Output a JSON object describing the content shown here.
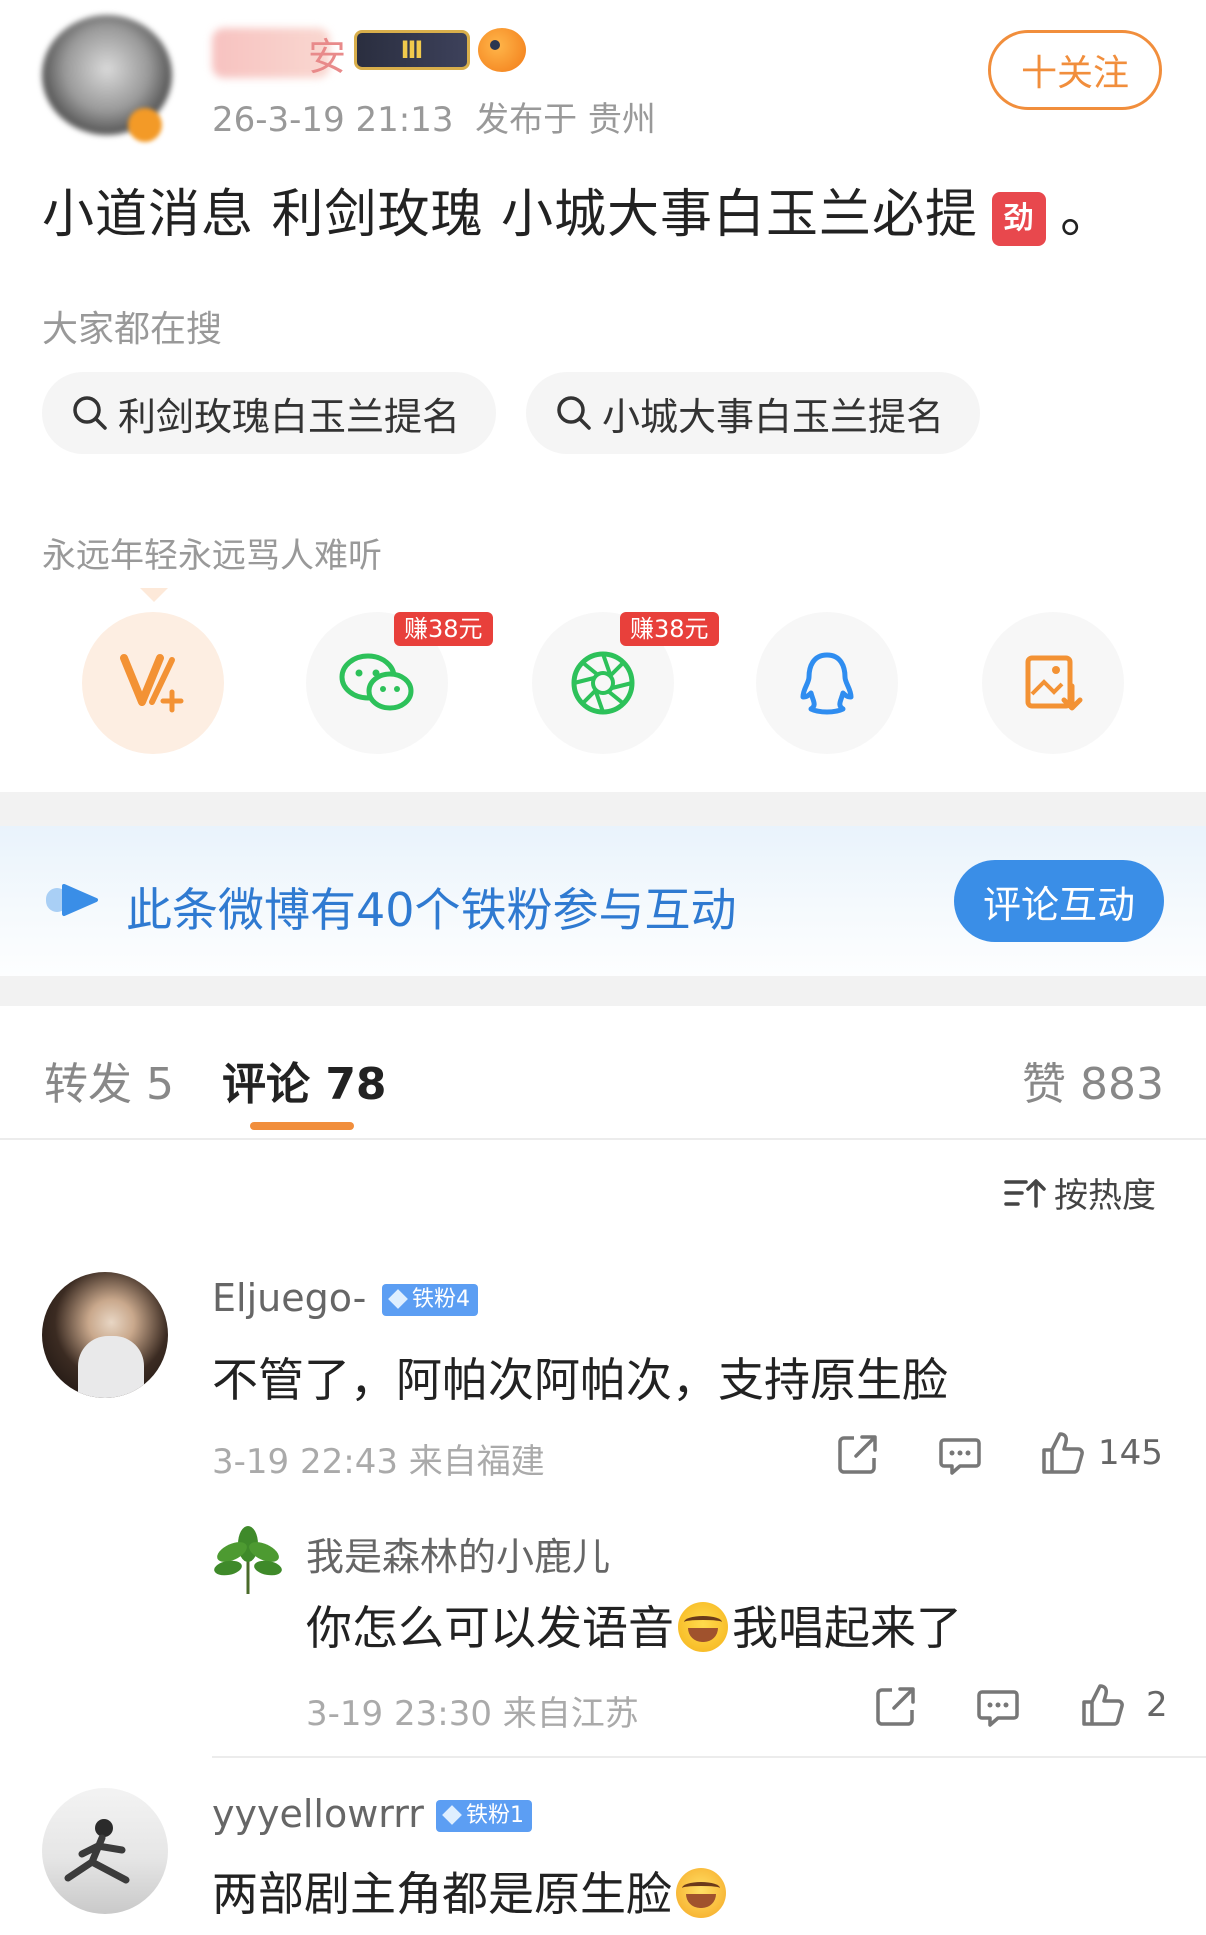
{
  "post": {
    "author_name_tail": "安",
    "crown_badge": "Ⅲ",
    "time": "26-3-19 21:13",
    "location": "发布于 贵州",
    "follow_label": "十关注",
    "text_main": "小道消息 利剑玫瑰 小城大事白玉兰必提",
    "rush_tag": "劲",
    "text_end": "。"
  },
  "search": {
    "title": "大家都在搜",
    "chips": [
      "利剑玫瑰白玉兰提名",
      "小城大事白玉兰提名"
    ]
  },
  "tagline": "永远年轻永远骂人难听",
  "share": {
    "earn_badge_1": "赚38元",
    "earn_badge_2": "赚38元",
    "icons": [
      "vplus-icon",
      "wechat-icon",
      "moments-icon",
      "qq-icon",
      "save-image-icon"
    ]
  },
  "fans_banner": {
    "text": "此条微博有40个铁粉参与互动",
    "button": "评论互动"
  },
  "tabs": {
    "repost": "转发 5",
    "comment": "评论 78",
    "like": "赞 883"
  },
  "sort": {
    "label": "按热度"
  },
  "comments": [
    {
      "name": "Eljuego-",
      "badge": "铁粉4",
      "text": "不管了，阿帕次阿帕次，支持原生脸",
      "meta": "3-19 22:43 来自福建",
      "likes": "145"
    },
    {
      "name": "我是森林的小鹿儿",
      "text_before": "你怎么可以发语音",
      "text_after": "我唱起来了",
      "meta": "3-19 23:30 来自江苏",
      "likes": "2"
    },
    {
      "name": "yyyellowrrr",
      "badge": "铁粉1",
      "text": "两部剧主角都是原生脸"
    }
  ],
  "colors": {
    "accent_orange": "#f18e3c",
    "link_blue": "#2f7ad1",
    "button_blue": "#3a8ee7",
    "earn_red": "#e8403b"
  }
}
